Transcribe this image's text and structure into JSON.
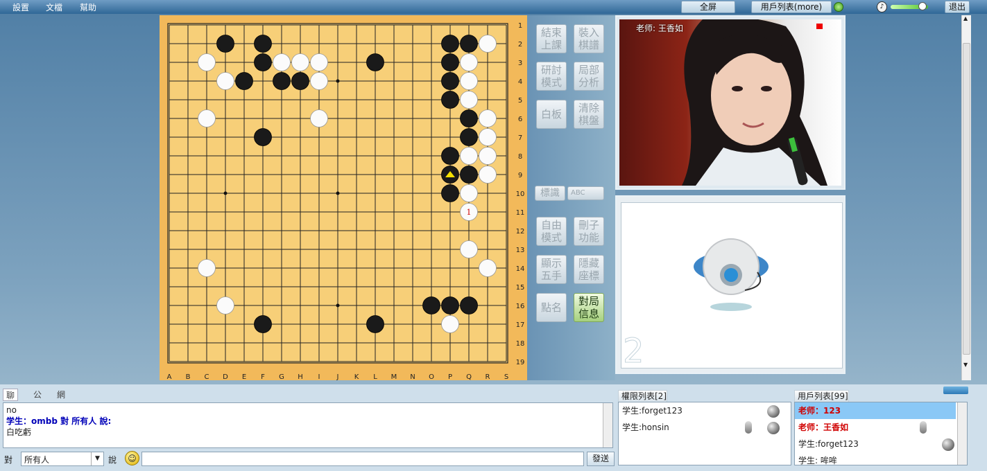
{
  "menu": {
    "settings": "設置",
    "docs": "文檔",
    "help": "幫助"
  },
  "topbar": {
    "fullscreen": "全屏",
    "userlist": "用戶列表(more)",
    "exit": "退出"
  },
  "board": {
    "cols": [
      "A",
      "B",
      "C",
      "D",
      "E",
      "F",
      "G",
      "H",
      "I",
      "J",
      "K",
      "L",
      "M",
      "N",
      "O",
      "P",
      "Q",
      "R",
      "S"
    ],
    "rows": [
      "1",
      "2",
      "3",
      "4",
      "5",
      "6",
      "7",
      "8",
      "9",
      "10",
      "11",
      "12",
      "13",
      "14",
      "15",
      "16",
      "17",
      "18",
      "19"
    ],
    "black": [
      [
        3,
        1
      ],
      [
        5,
        1
      ],
      [
        15,
        1
      ],
      [
        16,
        1
      ],
      [
        5,
        2
      ],
      [
        11,
        2
      ],
      [
        15,
        2
      ],
      [
        4,
        3
      ],
      [
        6,
        3
      ],
      [
        7,
        3
      ],
      [
        15,
        3
      ],
      [
        15,
        4
      ],
      [
        16,
        5
      ],
      [
        5,
        6
      ],
      [
        16,
        6
      ],
      [
        15,
        7
      ],
      [
        15,
        8
      ],
      [
        16,
        8
      ],
      [
        15,
        9
      ],
      [
        14,
        15
      ],
      [
        15,
        15
      ],
      [
        16,
        15
      ],
      [
        5,
        16
      ],
      [
        11,
        16
      ]
    ],
    "white": [
      [
        17,
        1
      ],
      [
        2,
        2
      ],
      [
        6,
        2
      ],
      [
        7,
        2
      ],
      [
        8,
        2
      ],
      [
        16,
        2
      ],
      [
        3,
        3
      ],
      [
        8,
        3
      ],
      [
        16,
        3
      ],
      [
        16,
        4
      ],
      [
        2,
        5
      ],
      [
        8,
        5
      ],
      [
        17,
        5
      ],
      [
        17,
        6
      ],
      [
        16,
        7
      ],
      [
        17,
        7
      ],
      [
        16,
        8
      ],
      [
        17,
        8
      ],
      [
        16,
        9
      ],
      [
        16,
        10
      ],
      [
        16,
        12
      ],
      [
        2,
        13
      ],
      [
        17,
        13
      ],
      [
        3,
        15
      ],
      [
        15,
        16
      ]
    ],
    "last_move_marker": [
      15,
      8
    ],
    "numbered": [
      {
        "pos": [
          16,
          10
        ],
        "label": "1"
      }
    ],
    "stars": [
      [
        3,
        3
      ],
      [
        9,
        3
      ],
      [
        3,
        9
      ],
      [
        9,
        9
      ],
      [
        3,
        15
      ],
      [
        9,
        15
      ],
      [
        15,
        9
      ]
    ]
  },
  "side_buttons": {
    "end_class": "結束\n上課",
    "load_record": "裝入\n棋譜",
    "study_mode": "研討\n模式",
    "local_analysis": "局部\n分析",
    "whiteboard": "白板",
    "clear_board": "清除\n棋盤",
    "marker": "標識",
    "abc": "ABC",
    "free_mode": "自由\n模式",
    "delete_stone": "刪子\n功能",
    "show_five": "顯示\n五手",
    "hide_coords": "隱藏\n座標",
    "roll_call": "點名",
    "game_info": "對局\n信息"
  },
  "video": {
    "teacher_label": "老师: 王香如",
    "second_slot_number": "2"
  },
  "chat": {
    "tabs": [
      "聊天",
      "公告",
      "網路"
    ],
    "lines": [
      "no",
      "学生：ombb 對 所有人 說:",
      "白吃虧"
    ],
    "to_label": "對",
    "recipient": "所有人",
    "say_label": "說",
    "send": "發送",
    "input_value": ""
  },
  "perm": {
    "title": "權限列表[2]",
    "items": [
      "学生:forget123",
      "学生:honsin"
    ]
  },
  "users": {
    "title": "用戶列表[99]",
    "items": [
      "老师：123",
      "老师：王香如",
      "学生:forget123",
      "学生: 哞哞"
    ]
  },
  "colors": {
    "board": "#f2b95a",
    "teacher_red": "#d00000",
    "highlight": "#8ac8f6"
  }
}
